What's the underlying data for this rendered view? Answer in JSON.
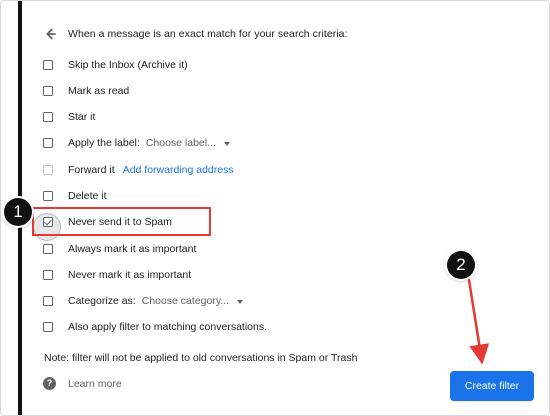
{
  "header": {
    "back_icon": "arrow-left-icon",
    "title": "When a message is an exact match for your search criteria:"
  },
  "options": [
    {
      "label": "Skip the Inbox (Archive it)",
      "checked": false,
      "disabled": false
    },
    {
      "label": "Mark as read",
      "checked": false,
      "disabled": false
    },
    {
      "label": "Star it",
      "checked": false,
      "disabled": false
    },
    {
      "label": "Apply the label:",
      "checked": false,
      "disabled": false,
      "select": "Choose label..."
    },
    {
      "label": "Forward it",
      "checked": false,
      "disabled": true,
      "link": "Add forwarding address"
    },
    {
      "label": "Delete it",
      "checked": false,
      "disabled": false
    },
    {
      "label": "Never send it to Spam",
      "checked": true,
      "disabled": false
    },
    {
      "label": "Always mark it as important",
      "checked": false,
      "disabled": false
    },
    {
      "label": "Never mark it as important",
      "checked": false,
      "disabled": false
    },
    {
      "label": "Categorize as:",
      "checked": false,
      "disabled": false,
      "select": "Choose category..."
    },
    {
      "label": "Also apply filter to matching conversations.",
      "checked": false,
      "disabled": false
    }
  ],
  "note": "Note: filter will not be applied to old conversations in Spam or Trash",
  "footer": {
    "help_icon": "help-icon",
    "help_glyph": "?",
    "learn_more": "Learn more",
    "create_filter": "Create filter"
  },
  "annotations": {
    "step_1": "1",
    "step_2": "2",
    "accent_color": "#e53935"
  }
}
